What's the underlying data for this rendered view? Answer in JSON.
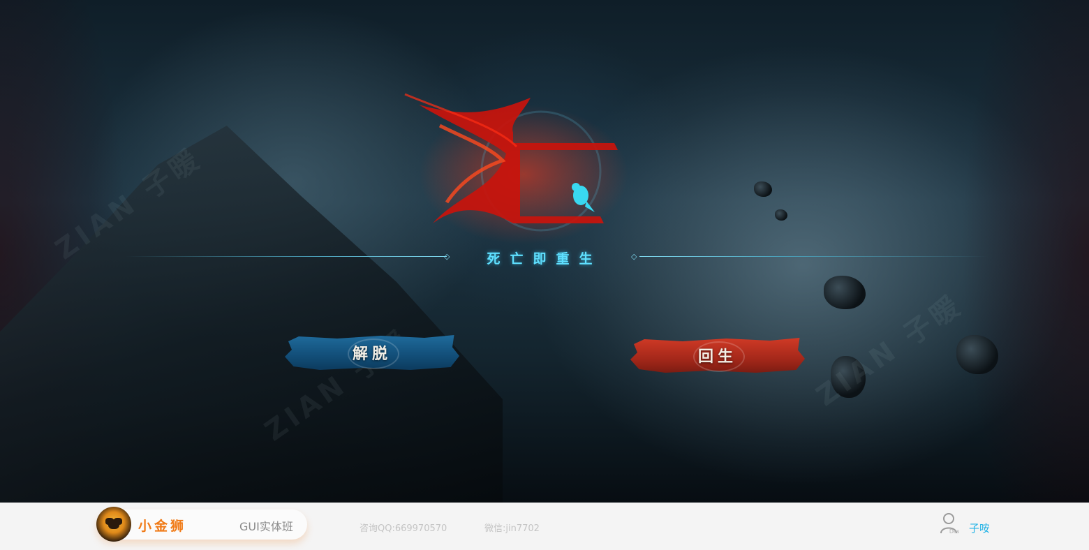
{
  "scene": {
    "tagline": "死亡即重生",
    "watermarks": [
      "ZIAN 子暖",
      "ZIAN 子暖",
      "ZIAN 子暖"
    ]
  },
  "buttons": {
    "escape_label": "解脱",
    "rebirth_label": "回生"
  },
  "footer": {
    "brand": "小金狮",
    "class_name": "GUI实体班",
    "qq": "咨询QQ:669970570",
    "wechat": "微信:jin7702",
    "user_icon_caption": "Des",
    "user_name": "子咹"
  },
  "colors": {
    "accent_cyan": "#5fe0ff",
    "escape_blue": "#1f6b9c",
    "rebirth_red": "#c2301f",
    "brand_orange": "#f07a16",
    "user_blue": "#1fb2e6"
  }
}
